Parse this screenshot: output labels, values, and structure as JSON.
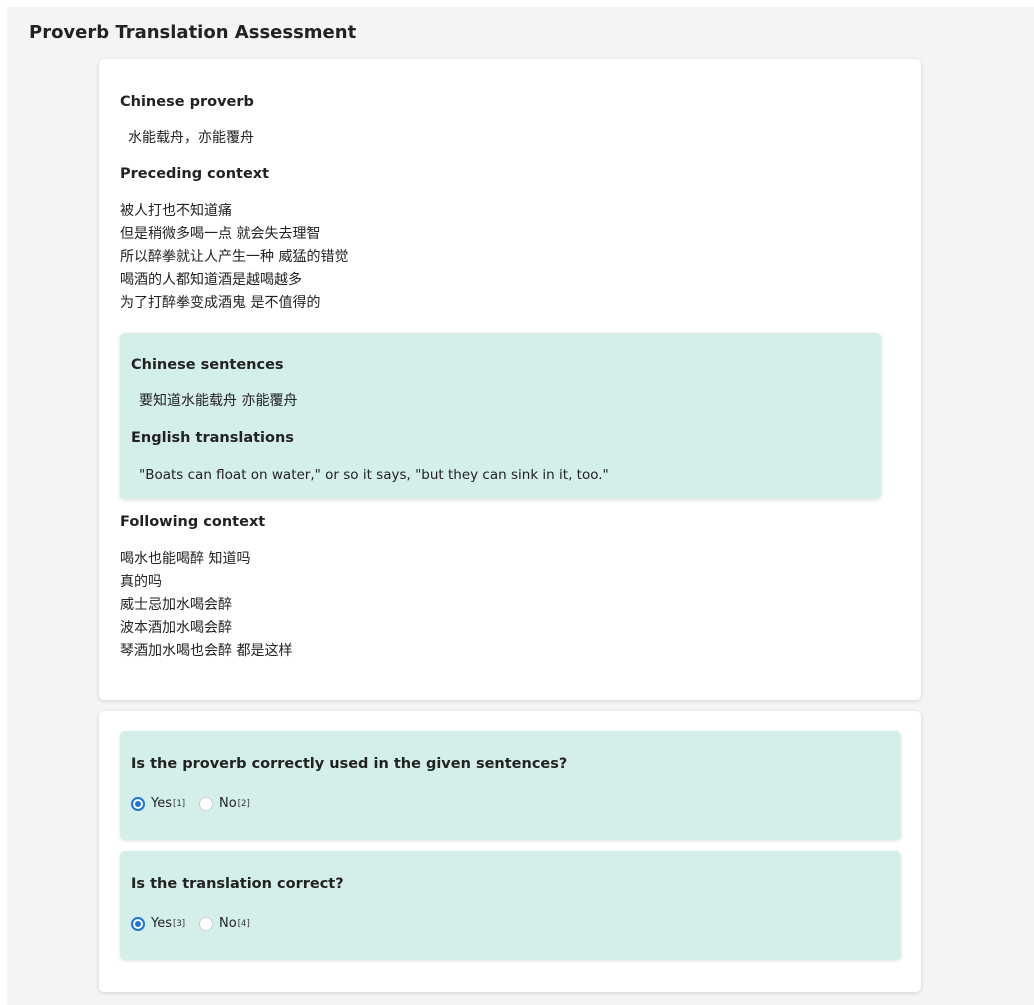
{
  "page": {
    "title": "Proverb Translation Assessment"
  },
  "context": {
    "proverb_heading": "Chinese proverb",
    "proverb": "水能载舟，亦能覆舟",
    "preceding_heading": "Preceding context",
    "preceding_lines": [
      "被人打也不知道痛",
      "但是稍微多喝一点 就会失去理智",
      "所以醉拳就让人产生一种 威猛的错觉",
      "喝酒的人都知道酒是越喝越多",
      "为了打醉拳变成酒鬼 是不值得的"
    ],
    "sentences_heading": "Chinese sentences",
    "sentence": "要知道水能载舟 亦能覆舟",
    "translations_heading": "English translations",
    "translation": "\"Boats can float on water,\" or so it says, \"but they can sink in it, too.\"",
    "following_heading": "Following context",
    "following_lines": [
      "喝水也能喝醉 知道吗",
      "真的吗",
      "威士忌加水喝会醉",
      "波本酒加水喝会醉",
      "琴酒加水喝也会醉 都是这样"
    ]
  },
  "questions": [
    {
      "text": "Is the proverb correctly used in the given sentences?",
      "options": [
        {
          "label": "Yes",
          "key": "[1]",
          "selected": true
        },
        {
          "label": "No",
          "key": "[2]",
          "selected": false
        }
      ]
    },
    {
      "text": "Is the translation correct?",
      "options": [
        {
          "label": "Yes",
          "key": "[3]",
          "selected": true
        },
        {
          "label": "No",
          "key": "[4]",
          "selected": false
        }
      ]
    }
  ],
  "colors": {
    "page_background": "#f5f4f3",
    "highlight_background": "#d4eeea",
    "radio_selected": "#1a73e8"
  }
}
